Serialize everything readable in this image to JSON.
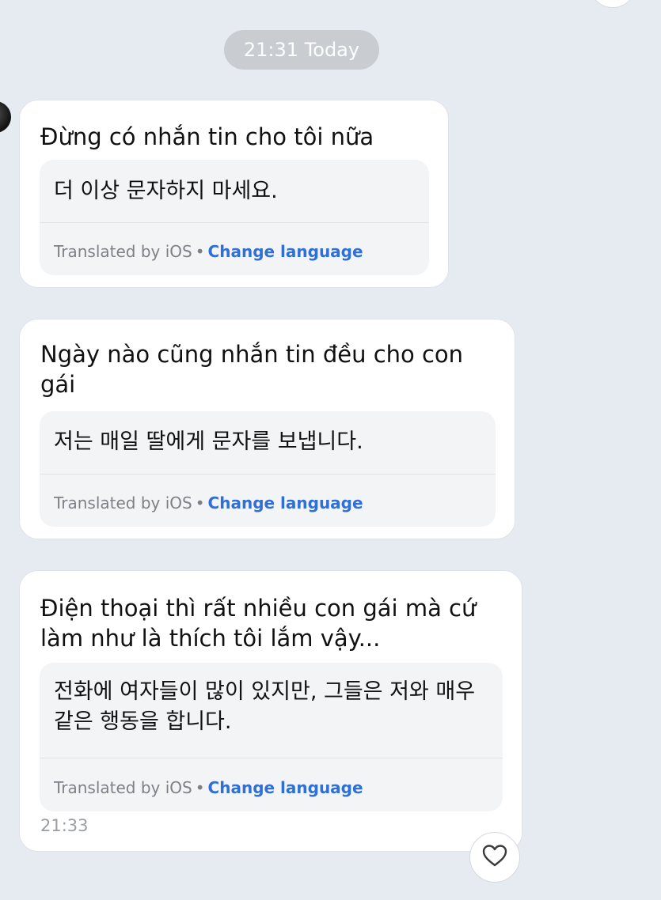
{
  "date_divider": "21:31 Today",
  "messages": [
    {
      "text": "Đừng có nhắn tin cho tôi nữa",
      "translation": "더 이상 문자하지 마세요.",
      "translated_by": "Translated by iOS",
      "separator": "•",
      "change_language": "Change language"
    },
    {
      "text": "Ngày nào cũng nhắn tin đều cho con gái",
      "translation": "저는 매일 딸에게 문자를 보냅니다.",
      "translated_by": "Translated by iOS",
      "separator": "•",
      "change_language": "Change language"
    },
    {
      "text": "Điện thoại thì rất nhiều con gái mà cứ làm như là thích tôi lắm vậy...",
      "translation": "전화에 여자들이 많이 있지만, 그들은 저와 매우 같은 행동을 합니다.",
      "translated_by": "Translated by iOS",
      "separator": "•",
      "change_language": "Change language",
      "time": "21:33"
    }
  ],
  "icons": {
    "reaction": "heart-outline-icon",
    "avatar": "contact-avatar"
  },
  "colors": {
    "background": "#e6ebf2",
    "link": "#2f6fd6",
    "pill": "#c9cdd2"
  }
}
